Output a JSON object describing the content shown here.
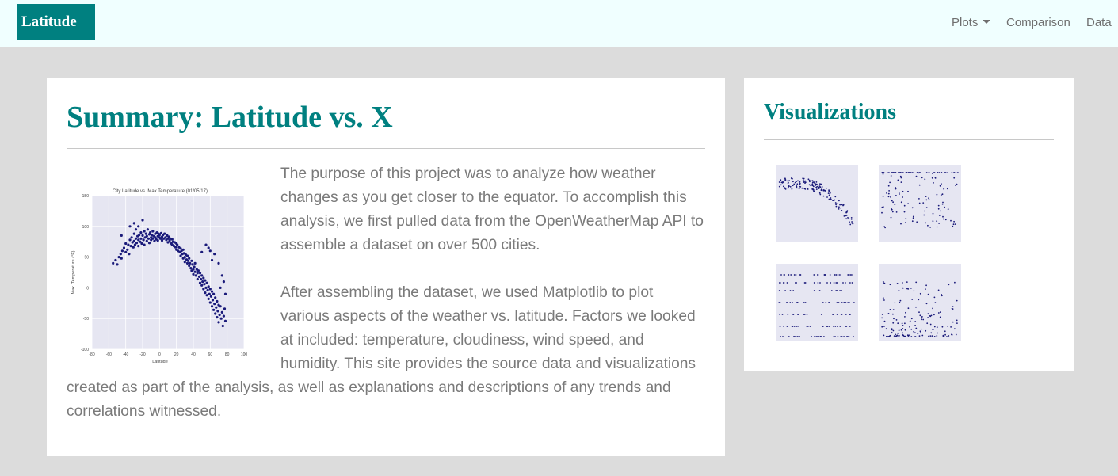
{
  "navbar": {
    "brand": "Latitude",
    "links": [
      {
        "label": "Plots",
        "dropdown": true
      },
      {
        "label": "Comparison",
        "dropdown": false
      },
      {
        "label": "Data",
        "dropdown": false
      }
    ]
  },
  "summary": {
    "title": "Summary: Latitude vs. X",
    "paragraph1": "The purpose of this project was to analyze how weather changes as you get closer to the equator. To accomplish this analysis, we first pulled data from the OpenWeatherMap API to assemble a dataset on over 500 cities.",
    "paragraph2": "After assembling the dataset, we used Matplotlib to plot various aspects of the weather vs. latitude. Factors we looked at included: temperature, cloudiness, wind speed, and humidity. This site provides the source data and visualizations created as part of the analysis, as well as explanations and descriptions of any trends and correlations witnessed."
  },
  "visualizations": {
    "title": "Visualizations",
    "thumbnails": [
      "Latitude vs. Max Temperature",
      "Latitude vs. Humidity",
      "Latitude vs. Cloudiness",
      "Latitude vs. Wind Speed"
    ]
  },
  "chart_data": {
    "type": "scatter",
    "title": "City Latitude vs. Max Temperature (01/05/17)",
    "xlabel": "Latitude",
    "ylabel": "Max. Temperature (°F)",
    "xlim": [
      -80,
      100
    ],
    "ylim": [
      -100,
      150
    ],
    "xticks": [
      "-80",
      "-60",
      "-40",
      "-20",
      "0",
      "20",
      "40",
      "60",
      "80",
      "100"
    ],
    "yticks": [
      "150",
      "100",
      "50",
      "0",
      "-50",
      "-100"
    ],
    "grid": true,
    "colors": {
      "marker": "#1a1a7a",
      "plot_background": "#e6e6f2",
      "grid": "#ffffff"
    },
    "points": [
      [
        -55,
        40
      ],
      [
        -52,
        45
      ],
      [
        -50,
        38
      ],
      [
        -48,
        50
      ],
      [
        -46,
        55
      ],
      [
        -45,
        48
      ],
      [
        -44,
        60
      ],
      [
        -42,
        65
      ],
      [
        -40,
        58
      ],
      [
        -40,
        72
      ],
      [
        -38,
        62
      ],
      [
        -37,
        70
      ],
      [
        -36,
        55
      ],
      [
        -35,
        78
      ],
      [
        -34,
        68
      ],
      [
        -33,
        82
      ],
      [
        -32,
        74
      ],
      [
        -31,
        66
      ],
      [
        -30,
        88
      ],
      [
        -30,
        76
      ],
      [
        -29,
        70
      ],
      [
        -28,
        95
      ],
      [
        -28,
        80
      ],
      [
        -27,
        73
      ],
      [
        -26,
        84
      ],
      [
        -25,
        78
      ],
      [
        -25,
        68
      ],
      [
        -24,
        86
      ],
      [
        -23,
        75
      ],
      [
        -22,
        90
      ],
      [
        -22,
        80
      ],
      [
        -21,
        72
      ],
      [
        -20,
        110
      ],
      [
        -20,
        85
      ],
      [
        -19,
        78
      ],
      [
        -18,
        92
      ],
      [
        -18,
        70
      ],
      [
        -17,
        82
      ],
      [
        -16,
        88
      ],
      [
        -15,
        76
      ],
      [
        -15,
        84
      ],
      [
        -14,
        95
      ],
      [
        -13,
        80
      ],
      [
        -12,
        87
      ],
      [
        -12,
        73
      ],
      [
        -11,
        90
      ],
      [
        -10,
        82
      ],
      [
        -10,
        78
      ],
      [
        -9,
        86
      ],
      [
        -8,
        80
      ],
      [
        -8,
        92
      ],
      [
        -7,
        84
      ],
      [
        -6,
        76
      ],
      [
        -5,
        88
      ],
      [
        -5,
        82
      ],
      [
        -4,
        79
      ],
      [
        -3,
        90
      ],
      [
        -2,
        84
      ],
      [
        -2,
        77
      ],
      [
        -1,
        88
      ],
      [
        0,
        82
      ],
      [
        0,
        86
      ],
      [
        1,
        80
      ],
      [
        2,
        89
      ],
      [
        3,
        83
      ],
      [
        3,
        77
      ],
      [
        4,
        86
      ],
      [
        5,
        80
      ],
      [
        6,
        88
      ],
      [
        7,
        82
      ],
      [
        8,
        78
      ],
      [
        9,
        85
      ],
      [
        10,
        80
      ],
      [
        10,
        74
      ],
      [
        11,
        83
      ],
      [
        12,
        77
      ],
      [
        13,
        80
      ],
      [
        14,
        72
      ],
      [
        15,
        79
      ],
      [
        15,
        70
      ],
      [
        16,
        75
      ],
      [
        17,
        68
      ],
      [
        18,
        74
      ],
      [
        19,
        66
      ],
      [
        20,
        72
      ],
      [
        20,
        62
      ],
      [
        21,
        70
      ],
      [
        22,
        60
      ],
      [
        23,
        66
      ],
      [
        24,
        58
      ],
      [
        25,
        64
      ],
      [
        25,
        52
      ],
      [
        26,
        60
      ],
      [
        27,
        55
      ],
      [
        28,
        62
      ],
      [
        28,
        48
      ],
      [
        29,
        56
      ],
      [
        30,
        50
      ],
      [
        30,
        42
      ],
      [
        31,
        54
      ],
      [
        32,
        46
      ],
      [
        33,
        40
      ],
      [
        33,
        52
      ],
      [
        34,
        44
      ],
      [
        35,
        36
      ],
      [
        35,
        48
      ],
      [
        36,
        40
      ],
      [
        37,
        32
      ],
      [
        38,
        44
      ],
      [
        38,
        28
      ],
      [
        39,
        38
      ],
      [
        40,
        30
      ],
      [
        40,
        22
      ],
      [
        41,
        34
      ],
      [
        42,
        26
      ],
      [
        42,
        40
      ],
      [
        43,
        20
      ],
      [
        44,
        30
      ],
      [
        45,
        24
      ],
      [
        45,
        14
      ],
      [
        46,
        28
      ],
      [
        47,
        18
      ],
      [
        48,
        8
      ],
      [
        48,
        24
      ],
      [
        49,
        14
      ],
      [
        50,
        4
      ],
      [
        50,
        20
      ],
      [
        51,
        10
      ],
      [
        52,
        -2
      ],
      [
        52,
        16
      ],
      [
        53,
        6
      ],
      [
        54,
        -8
      ],
      [
        54,
        12
      ],
      [
        55,
        0
      ],
      [
        56,
        -12
      ],
      [
        56,
        8
      ],
      [
        57,
        -4
      ],
      [
        58,
        -18
      ],
      [
        58,
        2
      ],
      [
        59,
        -10
      ],
      [
        60,
        -24
      ],
      [
        60,
        -2
      ],
      [
        61,
        -14
      ],
      [
        62,
        -30
      ],
      [
        62,
        -6
      ],
      [
        63,
        -20
      ],
      [
        64,
        -36
      ],
      [
        64,
        -10
      ],
      [
        65,
        -26
      ],
      [
        66,
        -42
      ],
      [
        66,
        -16
      ],
      [
        67,
        -32
      ],
      [
        68,
        -48
      ],
      [
        68,
        -22
      ],
      [
        69,
        -38
      ],
      [
        70,
        -56
      ],
      [
        70,
        -28
      ],
      [
        71,
        -44
      ],
      [
        72,
        -30
      ],
      [
        73,
        -50
      ],
      [
        74,
        -40
      ],
      [
        75,
        -62
      ],
      [
        76,
        -46
      ],
      [
        77,
        -34
      ],
      [
        78,
        -54
      ],
      [
        60,
        60
      ],
      [
        62,
        45
      ],
      [
        65,
        55
      ],
      [
        70,
        40
      ],
      [
        74,
        20
      ],
      [
        76,
        10
      ],
      [
        72,
        0
      ],
      [
        78,
        -10
      ],
      [
        -35,
        100
      ],
      [
        -30,
        105
      ],
      [
        -25,
        100
      ],
      [
        -45,
        85
      ],
      [
        55,
        70
      ],
      [
        58,
        65
      ],
      [
        50,
        58
      ]
    ]
  }
}
